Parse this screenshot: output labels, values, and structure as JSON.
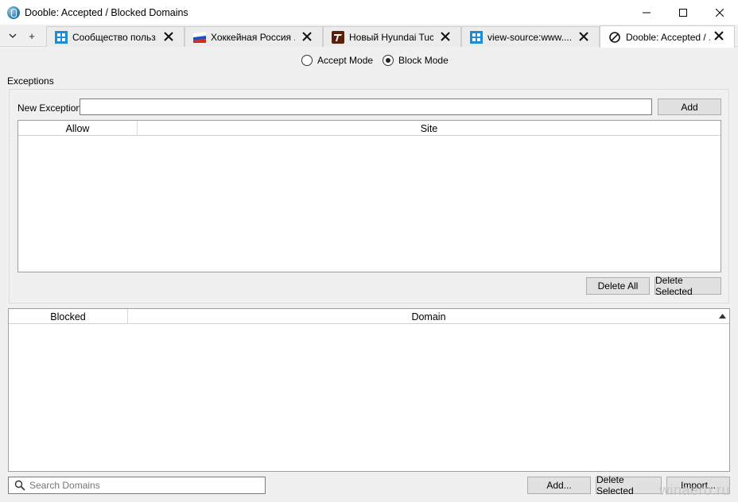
{
  "window": {
    "title": "Dooble: Accepted / Blocked Domains"
  },
  "tabs": [
    {
      "label": "Сообщество польз...",
      "icon": "grid-icon"
    },
    {
      "label": "Хоккейная Россия ...",
      "icon": "russia-flag-icon"
    },
    {
      "label": "Новый Hyundai Tuc...",
      "icon": "t-logo-icon"
    },
    {
      "label": "view-source:www....",
      "icon": "grid-icon"
    },
    {
      "label": "Dooble: Accepted / ...",
      "icon": "blocked-icon",
      "active": true
    }
  ],
  "tab_controls": {
    "menu": "⌄",
    "add": "+"
  },
  "mode": {
    "accept_label": "Accept Mode",
    "block_label": "Block Mode",
    "selected": "block"
  },
  "exceptions": {
    "section_label": "Exceptions",
    "new_label": "New Exception",
    "new_value": "",
    "add_button": "Add",
    "columns": [
      "Allow",
      "Site"
    ],
    "rows": [],
    "delete_all_button": "Delete All",
    "delete_selected_button": "Delete Selected"
  },
  "domains": {
    "columns": [
      "Blocked",
      "Domain"
    ],
    "rows": [],
    "sort_column": "Domain"
  },
  "footer": {
    "search_placeholder": "Search Domains",
    "add_button": "Add...",
    "delete_selected_button": "Delete Selected",
    "import_button": "Import..."
  },
  "watermark": "winaero.ru"
}
